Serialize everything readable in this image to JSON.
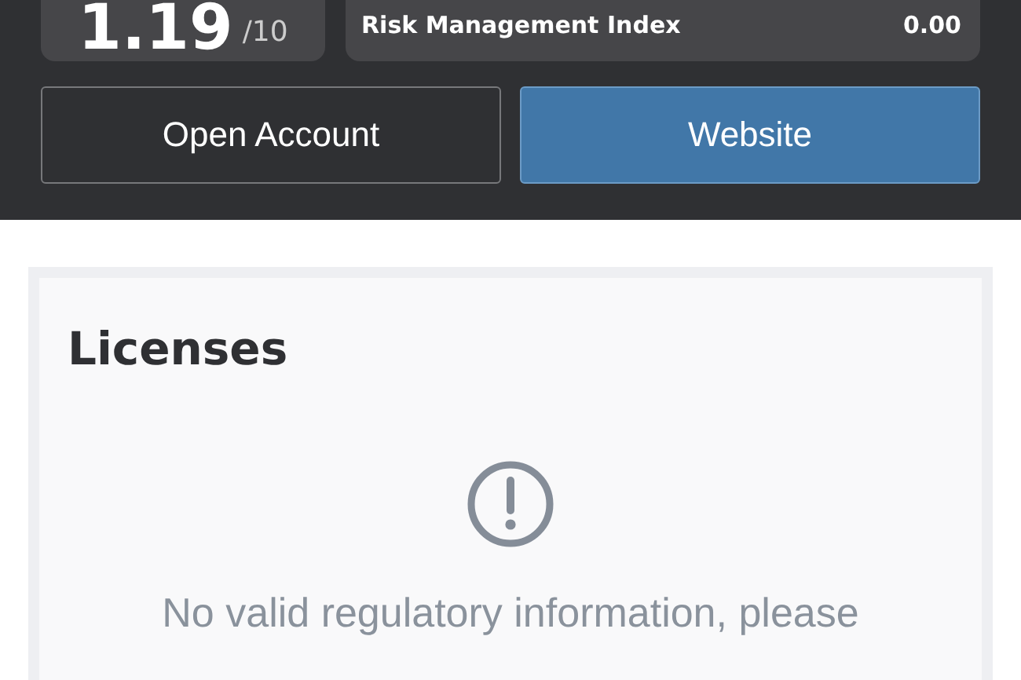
{
  "score": {
    "value": "1.19",
    "scale": "/10"
  },
  "indices": [
    {
      "label": "Risk Management Index",
      "value": "0.00"
    }
  ],
  "buttons": [
    {
      "label": "Open Account",
      "kind": "outline"
    },
    {
      "label": "Website",
      "kind": "primary"
    }
  ],
  "licenses": {
    "title": "Licenses",
    "message": "No valid regulatory information, please"
  }
}
